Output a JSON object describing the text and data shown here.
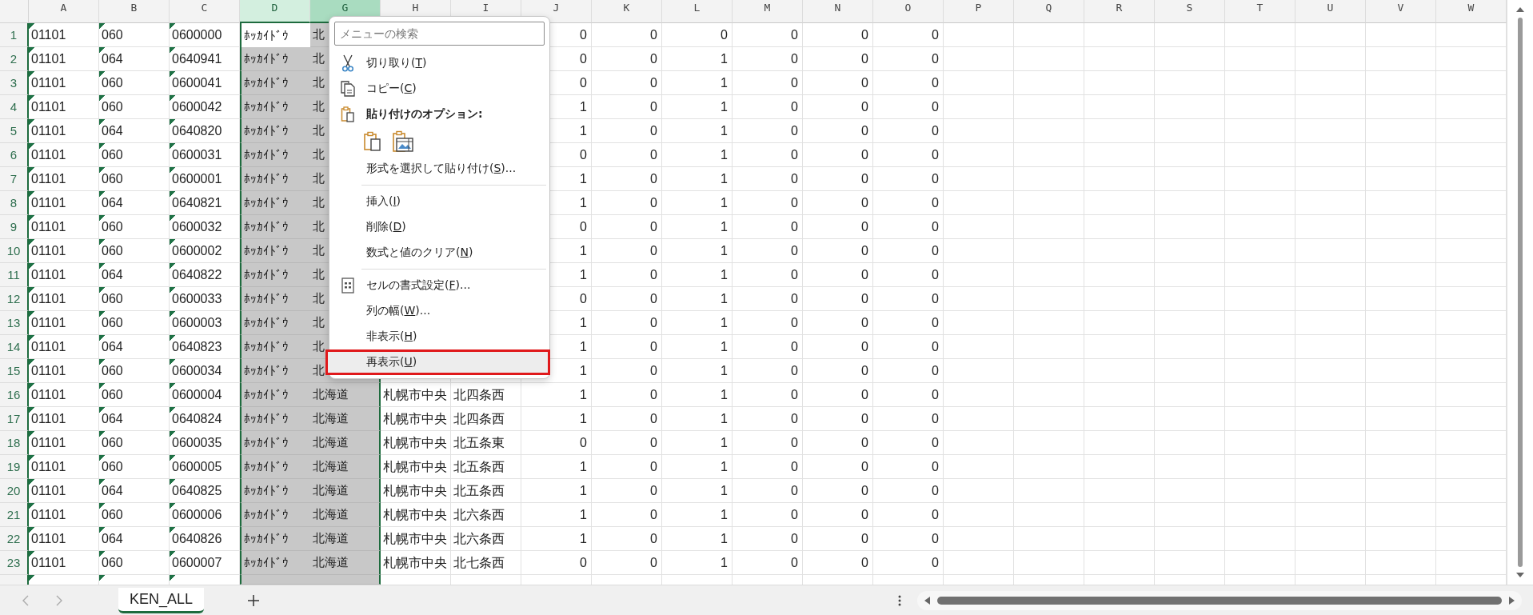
{
  "columns": [
    {
      "letter": "A",
      "flagged": true,
      "numeric": false,
      "selected": false,
      "hovered": false
    },
    {
      "letter": "B",
      "flagged": true,
      "numeric": false,
      "selected": false,
      "hovered": false
    },
    {
      "letter": "C",
      "flagged": true,
      "numeric": false,
      "selected": false,
      "hovered": false
    },
    {
      "letter": "D",
      "flagged": false,
      "numeric": false,
      "selected": true,
      "hovered": false
    },
    {
      "letter": "G",
      "flagged": false,
      "numeric": false,
      "selected": true,
      "hovered": true
    },
    {
      "letter": "H",
      "flagged": false,
      "numeric": false,
      "selected": false,
      "hovered": false
    },
    {
      "letter": "I",
      "flagged": false,
      "numeric": false,
      "selected": false,
      "hovered": false
    },
    {
      "letter": "J",
      "flagged": false,
      "numeric": true,
      "selected": false,
      "hovered": false
    },
    {
      "letter": "K",
      "flagged": false,
      "numeric": true,
      "selected": false,
      "hovered": false
    },
    {
      "letter": "L",
      "flagged": false,
      "numeric": true,
      "selected": false,
      "hovered": false
    },
    {
      "letter": "M",
      "flagged": false,
      "numeric": true,
      "selected": false,
      "hovered": false
    },
    {
      "letter": "N",
      "flagged": false,
      "numeric": true,
      "selected": false,
      "hovered": false
    },
    {
      "letter": "O",
      "flagged": false,
      "numeric": true,
      "selected": false,
      "hovered": false
    },
    {
      "letter": "P",
      "selected": false,
      "hovered": false
    },
    {
      "letter": "Q",
      "selected": false,
      "hovered": false
    },
    {
      "letter": "R",
      "selected": false,
      "hovered": false
    },
    {
      "letter": "S",
      "selected": false,
      "hovered": false
    },
    {
      "letter": "T",
      "selected": false,
      "hovered": false
    },
    {
      "letter": "U",
      "selected": false,
      "hovered": false
    },
    {
      "letter": "V",
      "selected": false,
      "hovered": false
    },
    {
      "letter": "W",
      "selected": false,
      "hovered": false
    }
  ],
  "rows": [
    {
      "number": "1",
      "active": true,
      "cells": {
        "A": "01101",
        "B": "060",
        "C": "0600000",
        "D": "ﾎｯｶｲﾄﾞｳ",
        "G": "北",
        "J": "0",
        "K": "0",
        "L": "0",
        "M": "0",
        "N": "0",
        "O": "0"
      }
    },
    {
      "number": "2",
      "active": false,
      "cells": {
        "A": "01101",
        "B": "064",
        "C": "0640941",
        "D": "ﾎｯｶｲﾄﾞｳ",
        "G": "北",
        "J": "0",
        "K": "0",
        "L": "1",
        "M": "0",
        "N": "0",
        "O": "0"
      }
    },
    {
      "number": "3",
      "active": false,
      "cells": {
        "A": "01101",
        "B": "060",
        "C": "0600041",
        "D": "ﾎｯｶｲﾄﾞｳ",
        "G": "北",
        "J": "0",
        "K": "0",
        "L": "1",
        "M": "0",
        "N": "0",
        "O": "0"
      }
    },
    {
      "number": "4",
      "active": false,
      "cells": {
        "A": "01101",
        "B": "060",
        "C": "0600042",
        "D": "ﾎｯｶｲﾄﾞｳ",
        "G": "北",
        "J": "1",
        "K": "0",
        "L": "1",
        "M": "0",
        "N": "0",
        "O": "0"
      }
    },
    {
      "number": "5",
      "active": false,
      "cells": {
        "A": "01101",
        "B": "064",
        "C": "0640820",
        "D": "ﾎｯｶｲﾄﾞｳ",
        "G": "北",
        "J": "1",
        "K": "0",
        "L": "1",
        "M": "0",
        "N": "0",
        "O": "0"
      }
    },
    {
      "number": "6",
      "active": false,
      "cells": {
        "A": "01101",
        "B": "060",
        "C": "0600031",
        "D": "ﾎｯｶｲﾄﾞｳ",
        "G": "北",
        "J": "0",
        "K": "0",
        "L": "1",
        "M": "0",
        "N": "0",
        "O": "0"
      }
    },
    {
      "number": "7",
      "active": false,
      "cells": {
        "A": "01101",
        "B": "060",
        "C": "0600001",
        "D": "ﾎｯｶｲﾄﾞｳ",
        "G": "北",
        "J": "1",
        "K": "0",
        "L": "1",
        "M": "0",
        "N": "0",
        "O": "0"
      }
    },
    {
      "number": "8",
      "active": false,
      "cells": {
        "A": "01101",
        "B": "064",
        "C": "0640821",
        "D": "ﾎｯｶｲﾄﾞｳ",
        "G": "北",
        "J": "1",
        "K": "0",
        "L": "1",
        "M": "0",
        "N": "0",
        "O": "0"
      }
    },
    {
      "number": "9",
      "active": false,
      "cells": {
        "A": "01101",
        "B": "060",
        "C": "0600032",
        "D": "ﾎｯｶｲﾄﾞｳ",
        "G": "北",
        "J": "0",
        "K": "0",
        "L": "1",
        "M": "0",
        "N": "0",
        "O": "0"
      }
    },
    {
      "number": "10",
      "active": false,
      "cells": {
        "A": "01101",
        "B": "060",
        "C": "0600002",
        "D": "ﾎｯｶｲﾄﾞｳ",
        "G": "北",
        "J": "1",
        "K": "0",
        "L": "1",
        "M": "0",
        "N": "0",
        "O": "0"
      }
    },
    {
      "number": "11",
      "active": false,
      "cells": {
        "A": "01101",
        "B": "064",
        "C": "0640822",
        "D": "ﾎｯｶｲﾄﾞｳ",
        "G": "北",
        "J": "1",
        "K": "0",
        "L": "1",
        "M": "0",
        "N": "0",
        "O": "0"
      }
    },
    {
      "number": "12",
      "active": false,
      "cells": {
        "A": "01101",
        "B": "060",
        "C": "0600033",
        "D": "ﾎｯｶｲﾄﾞｳ",
        "G": "北",
        "J": "0",
        "K": "0",
        "L": "1",
        "M": "0",
        "N": "0",
        "O": "0"
      }
    },
    {
      "number": "13",
      "active": false,
      "cells": {
        "A": "01101",
        "B": "060",
        "C": "0600003",
        "D": "ﾎｯｶｲﾄﾞｳ",
        "G": "北",
        "J": "1",
        "K": "0",
        "L": "1",
        "M": "0",
        "N": "0",
        "O": "0"
      }
    },
    {
      "number": "14",
      "active": false,
      "cells": {
        "A": "01101",
        "B": "064",
        "C": "0640823",
        "D": "ﾎｯｶｲﾄﾞｳ",
        "G": "北",
        "J": "1",
        "K": "0",
        "L": "1",
        "M": "0",
        "N": "0",
        "O": "0"
      }
    },
    {
      "number": "15",
      "active": false,
      "cells": {
        "A": "01101",
        "B": "060",
        "C": "0600034",
        "D": "ﾎｯｶｲﾄﾞｳ",
        "G": "北",
        "J": "1",
        "K": "0",
        "L": "1",
        "M": "0",
        "N": "0",
        "O": "0"
      }
    },
    {
      "number": "16",
      "active": false,
      "cells": {
        "A": "01101",
        "B": "060",
        "C": "0600004",
        "D": "ﾎｯｶｲﾄﾞｳ",
        "G": "北海道",
        "H": "札幌市中央",
        "I": "北四条西",
        "J": "1",
        "K": "0",
        "L": "1",
        "M": "0",
        "N": "0",
        "O": "0"
      }
    },
    {
      "number": "17",
      "active": false,
      "cells": {
        "A": "01101",
        "B": "064",
        "C": "0640824",
        "D": "ﾎｯｶｲﾄﾞｳ",
        "G": "北海道",
        "H": "札幌市中央",
        "I": "北四条西",
        "J": "1",
        "K": "0",
        "L": "1",
        "M": "0",
        "N": "0",
        "O": "0"
      }
    },
    {
      "number": "18",
      "active": false,
      "cells": {
        "A": "01101",
        "B": "060",
        "C": "0600035",
        "D": "ﾎｯｶｲﾄﾞｳ",
        "G": "北海道",
        "H": "札幌市中央",
        "I": "北五条東",
        "J": "0",
        "K": "0",
        "L": "1",
        "M": "0",
        "N": "0",
        "O": "0"
      }
    },
    {
      "number": "19",
      "active": false,
      "cells": {
        "A": "01101",
        "B": "060",
        "C": "0600005",
        "D": "ﾎｯｶｲﾄﾞｳ",
        "G": "北海道",
        "H": "札幌市中央",
        "I": "北五条西",
        "J": "1",
        "K": "0",
        "L": "1",
        "M": "0",
        "N": "0",
        "O": "0"
      }
    },
    {
      "number": "20",
      "active": false,
      "cells": {
        "A": "01101",
        "B": "064",
        "C": "0640825",
        "D": "ﾎｯｶｲﾄﾞｳ",
        "G": "北海道",
        "H": "札幌市中央",
        "I": "北五条西",
        "J": "1",
        "K": "0",
        "L": "1",
        "M": "0",
        "N": "0",
        "O": "0"
      }
    },
    {
      "number": "21",
      "active": false,
      "cells": {
        "A": "01101",
        "B": "060",
        "C": "0600006",
        "D": "ﾎｯｶｲﾄﾞｳ",
        "G": "北海道",
        "H": "札幌市中央",
        "I": "北六条西",
        "J": "1",
        "K": "0",
        "L": "1",
        "M": "0",
        "N": "0",
        "O": "0"
      }
    },
    {
      "number": "22",
      "active": false,
      "cells": {
        "A": "01101",
        "B": "064",
        "C": "0640826",
        "D": "ﾎｯｶｲﾄﾞｳ",
        "G": "北海道",
        "H": "札幌市中央",
        "I": "北六条西",
        "J": "1",
        "K": "0",
        "L": "1",
        "M": "0",
        "N": "0",
        "O": "0"
      }
    },
    {
      "number": "23",
      "active": false,
      "cells": {
        "A": "01101",
        "B": "060",
        "C": "0600007",
        "D": "ﾎｯｶｲﾄﾞｳ",
        "G": "北海道",
        "H": "札幌市中央",
        "I": "北七条西",
        "J": "0",
        "K": "0",
        "L": "1",
        "M": "0",
        "N": "0",
        "O": "0"
      }
    }
  ],
  "context_menu": {
    "search": {
      "placeholder": "メニューの検索"
    },
    "items": [
      {
        "kind": "command",
        "label": "切り取り(",
        "hotkey": "T",
        "tail": ")",
        "highlighted": false
      },
      {
        "kind": "command",
        "label": "コピー(",
        "hotkey": "C",
        "tail": ")",
        "highlighted": false
      },
      {
        "kind": "heading",
        "label": "貼り付けのオプション:"
      },
      {
        "kind": "paste_icons"
      },
      {
        "kind": "command",
        "label": "形式を選択して貼り付け(",
        "hotkey": "S",
        "tail": ")...",
        "highlighted": false
      },
      {
        "kind": "divider"
      },
      {
        "kind": "command",
        "label": "挿入(",
        "hotkey": "I",
        "tail": ")",
        "highlighted": false
      },
      {
        "kind": "command",
        "label": "削除(",
        "hotkey": "D",
        "tail": ")",
        "highlighted": false
      },
      {
        "kind": "command",
        "label": "数式と値のクリア(",
        "hotkey": "N",
        "tail": ")",
        "highlighted": false
      },
      {
        "kind": "divider"
      },
      {
        "kind": "command",
        "label": "セルの書式設定(",
        "hotkey": "F",
        "tail": ")...",
        "highlighted": false
      },
      {
        "kind": "command",
        "label": "列の幅(",
        "hotkey": "W",
        "tail": ")...",
        "highlighted": false
      },
      {
        "kind": "command",
        "label": "非表示(",
        "hotkey": "H",
        "tail": ")",
        "highlighted": false
      },
      {
        "kind": "command",
        "label": "再表示(",
        "hotkey": "U",
        "tail": ")",
        "highlighted": true
      }
    ]
  },
  "sheet_tabs": [
    {
      "label": "KEN_ALL",
      "selected": true
    }
  ]
}
